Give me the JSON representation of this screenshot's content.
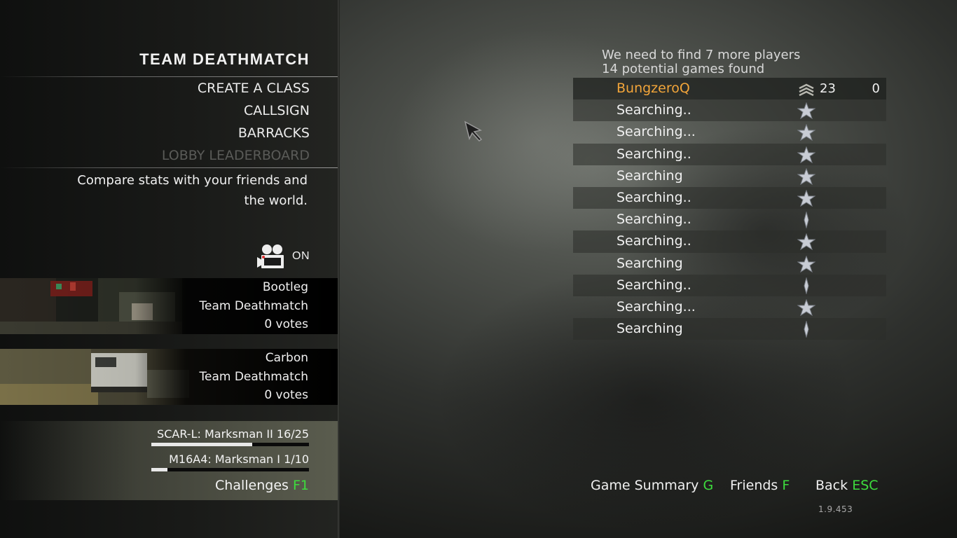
{
  "lobby": {
    "mode_title": "TEAM DEATHMATCH",
    "menu": [
      {
        "label": "CREATE A CLASS",
        "enabled": true
      },
      {
        "label": "CALLSIGN",
        "enabled": true
      },
      {
        "label": "BARRACKS",
        "enabled": true
      },
      {
        "label": "LOBBY LEADERBOARD",
        "enabled": false
      }
    ],
    "description": "Compare stats with your friends and the world.",
    "theater": {
      "icon": "film-camera-icon",
      "state": "ON"
    }
  },
  "maps": [
    {
      "name": "Bootleg",
      "mode": "Team Deathmatch",
      "votes": "0 votes"
    },
    {
      "name": "Carbon",
      "mode": "Team Deathmatch",
      "votes": "0 votes"
    }
  ],
  "challenges": {
    "items": [
      {
        "label": "SCAR-L: Marksman II  16/25",
        "progress": 0.64
      },
      {
        "label": "M16A4: Marksman I  1/10",
        "progress": 0.1
      }
    ],
    "link_label": "Challenges",
    "link_key": "F1"
  },
  "matchmaking": {
    "need_players": "We need to find 7 more players",
    "games_found": "14 potential games found"
  },
  "players": [
    {
      "name": "BungzeroQ",
      "rank_icon": "sergeant-chevron-icon",
      "level": "23",
      "score": "0",
      "is_self": true
    },
    {
      "name": "Searching..",
      "rank_icon": "star-icon"
    },
    {
      "name": "Searching...",
      "rank_icon": "star-icon"
    },
    {
      "name": "Searching..",
      "rank_icon": "star-icon"
    },
    {
      "name": "Searching",
      "rank_icon": "star-icon"
    },
    {
      "name": "Searching..",
      "rank_icon": "star-icon"
    },
    {
      "name": "Searching..",
      "rank_icon": "star-icon"
    },
    {
      "name": "Searching..",
      "rank_icon": "star-icon"
    },
    {
      "name": "Searching",
      "rank_icon": "star-icon"
    },
    {
      "name": "Searching..",
      "rank_icon": "star-icon"
    },
    {
      "name": "Searching...",
      "rank_icon": "star-icon"
    },
    {
      "name": "Searching",
      "rank_icon": "star-icon"
    }
  ],
  "actions": [
    {
      "label": "Game Summary",
      "key": "G"
    },
    {
      "label": "Friends",
      "key": "F"
    },
    {
      "label": "Back",
      "key": "ESC"
    }
  ],
  "version": "1.9.453",
  "colors": {
    "key_accent": "#3ddc3d",
    "self_name": "#f2a53a",
    "disabled": "#5a5b58"
  }
}
